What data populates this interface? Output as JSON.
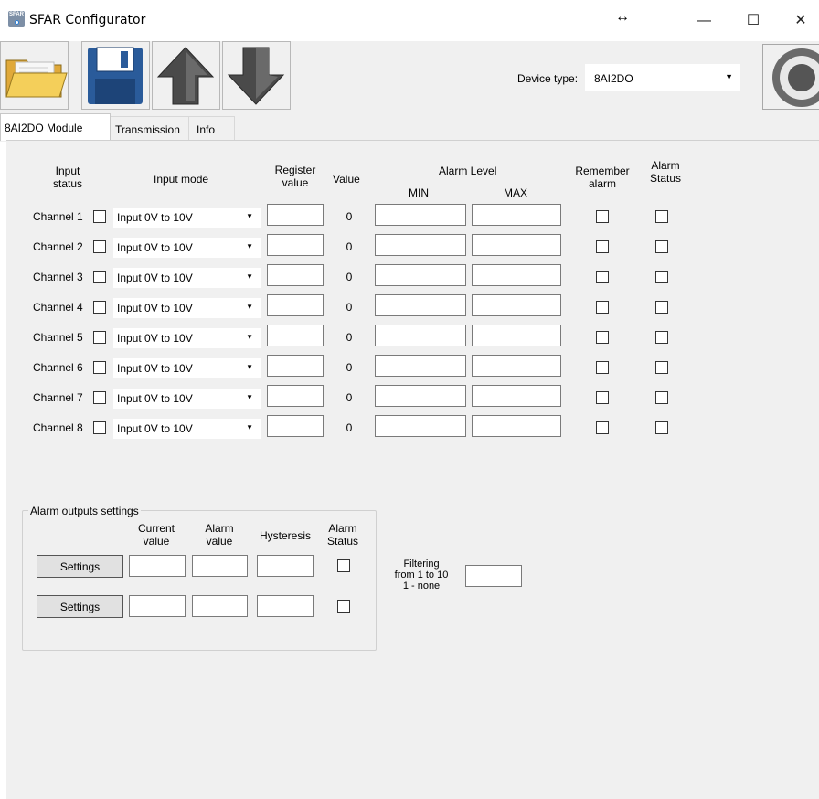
{
  "window": {
    "title": "SFAR Configurator",
    "icon_text": "SFAR",
    "resize_glyph": "↔",
    "minimize_glyph": "—",
    "maximize_glyph": "☐",
    "close_glyph": "✕"
  },
  "toolbar": {
    "device_type_label": "Device type:",
    "device_type_value": "8AI2DO",
    "icons": [
      "folder-open-icon",
      "floppy-disk-icon",
      "arrow-up-icon",
      "arrow-down-icon",
      "connect-icon"
    ]
  },
  "tabs": [
    {
      "label": "8AI2DO Module",
      "active": true
    },
    {
      "label": "Transmission",
      "active": false
    },
    {
      "label": "Info",
      "active": false
    }
  ],
  "headers": {
    "input_status": "Input\nstatus",
    "input_mode": "Input mode",
    "register_value": "Register\nvalue",
    "value": "Value",
    "alarm_level": "Alarm Level",
    "min": "MIN",
    "max": "MAX",
    "remember_alarm": "Remember\nalarm",
    "alarm_status": "Alarm\nStatus"
  },
  "channels": [
    {
      "label": "Channel 1",
      "mode": "Input 0V to 10V",
      "value": "0"
    },
    {
      "label": "Channel 2",
      "mode": "Input 0V to 10V",
      "value": "0"
    },
    {
      "label": "Channel 3",
      "mode": "Input 0V to 10V",
      "value": "0"
    },
    {
      "label": "Channel 4",
      "mode": "Input 0V to 10V",
      "value": "0"
    },
    {
      "label": "Channel 5",
      "mode": "Input 0V to 10V",
      "value": "0"
    },
    {
      "label": "Channel 6",
      "mode": "Input 0V to 10V",
      "value": "0"
    },
    {
      "label": "Channel 7",
      "mode": "Input 0V to 10V",
      "value": "0"
    },
    {
      "label": "Channel 8",
      "mode": "Input 0V to 10V",
      "value": "0"
    }
  ],
  "alarm_outputs": {
    "title": "Alarm outputs settings",
    "current_value_header": "Current\nvalue",
    "alarm_value_header": "Alarm\nvalue",
    "hysteresis_header": "Hysteresis",
    "alarm_status_header": "Alarm\nStatus",
    "rows": [
      {
        "button_label": "Settings"
      },
      {
        "button_label": "Settings"
      }
    ]
  },
  "filtering": {
    "label": "Filtering\nfrom 1 to 10\n1 - none"
  },
  "colors": {
    "panel_bg": "#f0f0f0",
    "window_bg": "#ffffff",
    "folder_yellow": "#f2c94c",
    "disk_blue": "#2a5b9a",
    "arrow_gray": "#555555"
  }
}
